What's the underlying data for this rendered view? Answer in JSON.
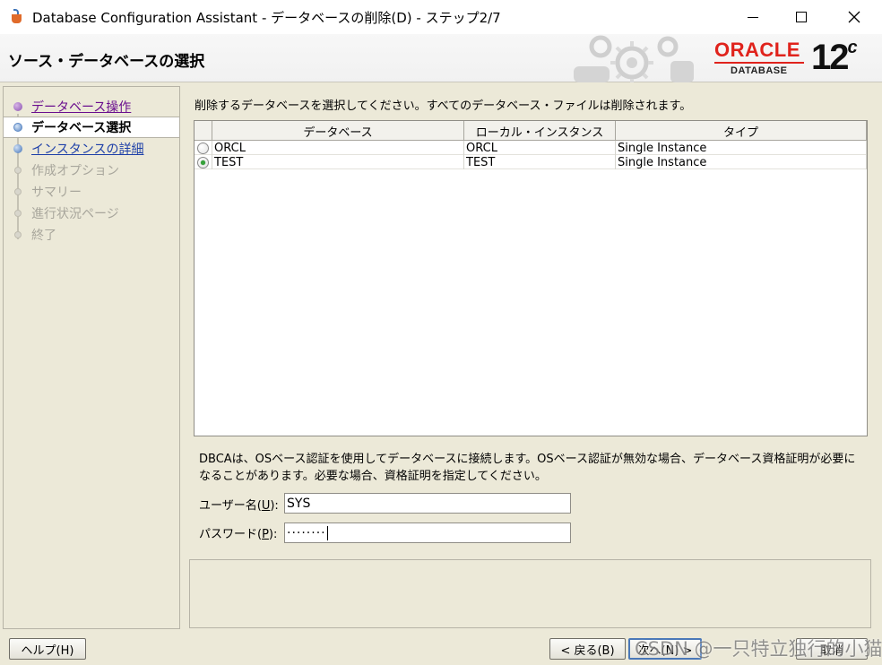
{
  "window": {
    "title": "Database Configuration Assistant - データベースの削除(D) - ステップ2/7"
  },
  "header": {
    "title": "ソース・データベースの選択",
    "logo": {
      "oracle": "ORACLE",
      "database": "DATABASE",
      "version": "12",
      "version_suffix": "c"
    }
  },
  "nav": {
    "items": [
      {
        "label": "データベース操作",
        "state": "done"
      },
      {
        "label": "データベース選択",
        "state": "active"
      },
      {
        "label": "インスタンスの詳細",
        "state": "link"
      },
      {
        "label": "作成オプション",
        "state": "disabled"
      },
      {
        "label": "サマリー",
        "state": "disabled"
      },
      {
        "label": "進行状況ページ",
        "state": "disabled"
      },
      {
        "label": "終了",
        "state": "disabled"
      }
    ]
  },
  "main": {
    "instruction": "削除するデータベースを選択してください。すべてのデータベース・ファイルは削除されます。",
    "table": {
      "columns": [
        "データベース",
        "ローカル・インスタンス",
        "タイプ"
      ],
      "rows": [
        {
          "selected": false,
          "database": "ORCL",
          "instance": "ORCL",
          "type": "Single Instance"
        },
        {
          "selected": true,
          "database": "TEST",
          "instance": "TEST",
          "type": "Single Instance"
        }
      ]
    },
    "note": "DBCAは、OSベース認証を使用してデータベースに接続します。OSベース認証が無効な場合、データベース資格証明が必要になることがあります。必要な場合、資格証明を指定してください。",
    "username": {
      "label_prefix": "ユーザー名(",
      "mnemonic": "U",
      "label_suffix": "):",
      "value": "SYS"
    },
    "password": {
      "label_prefix": "パスワード(",
      "mnemonic": "P",
      "label_suffix": "):",
      "value": "········"
    }
  },
  "buttons": {
    "help": "ヘルプ(H)",
    "back": "< 戻る(B)",
    "next": "次へ(N) >",
    "cancel": "取消"
  },
  "watermark": "CSDN @一只特立独行的小猫"
}
